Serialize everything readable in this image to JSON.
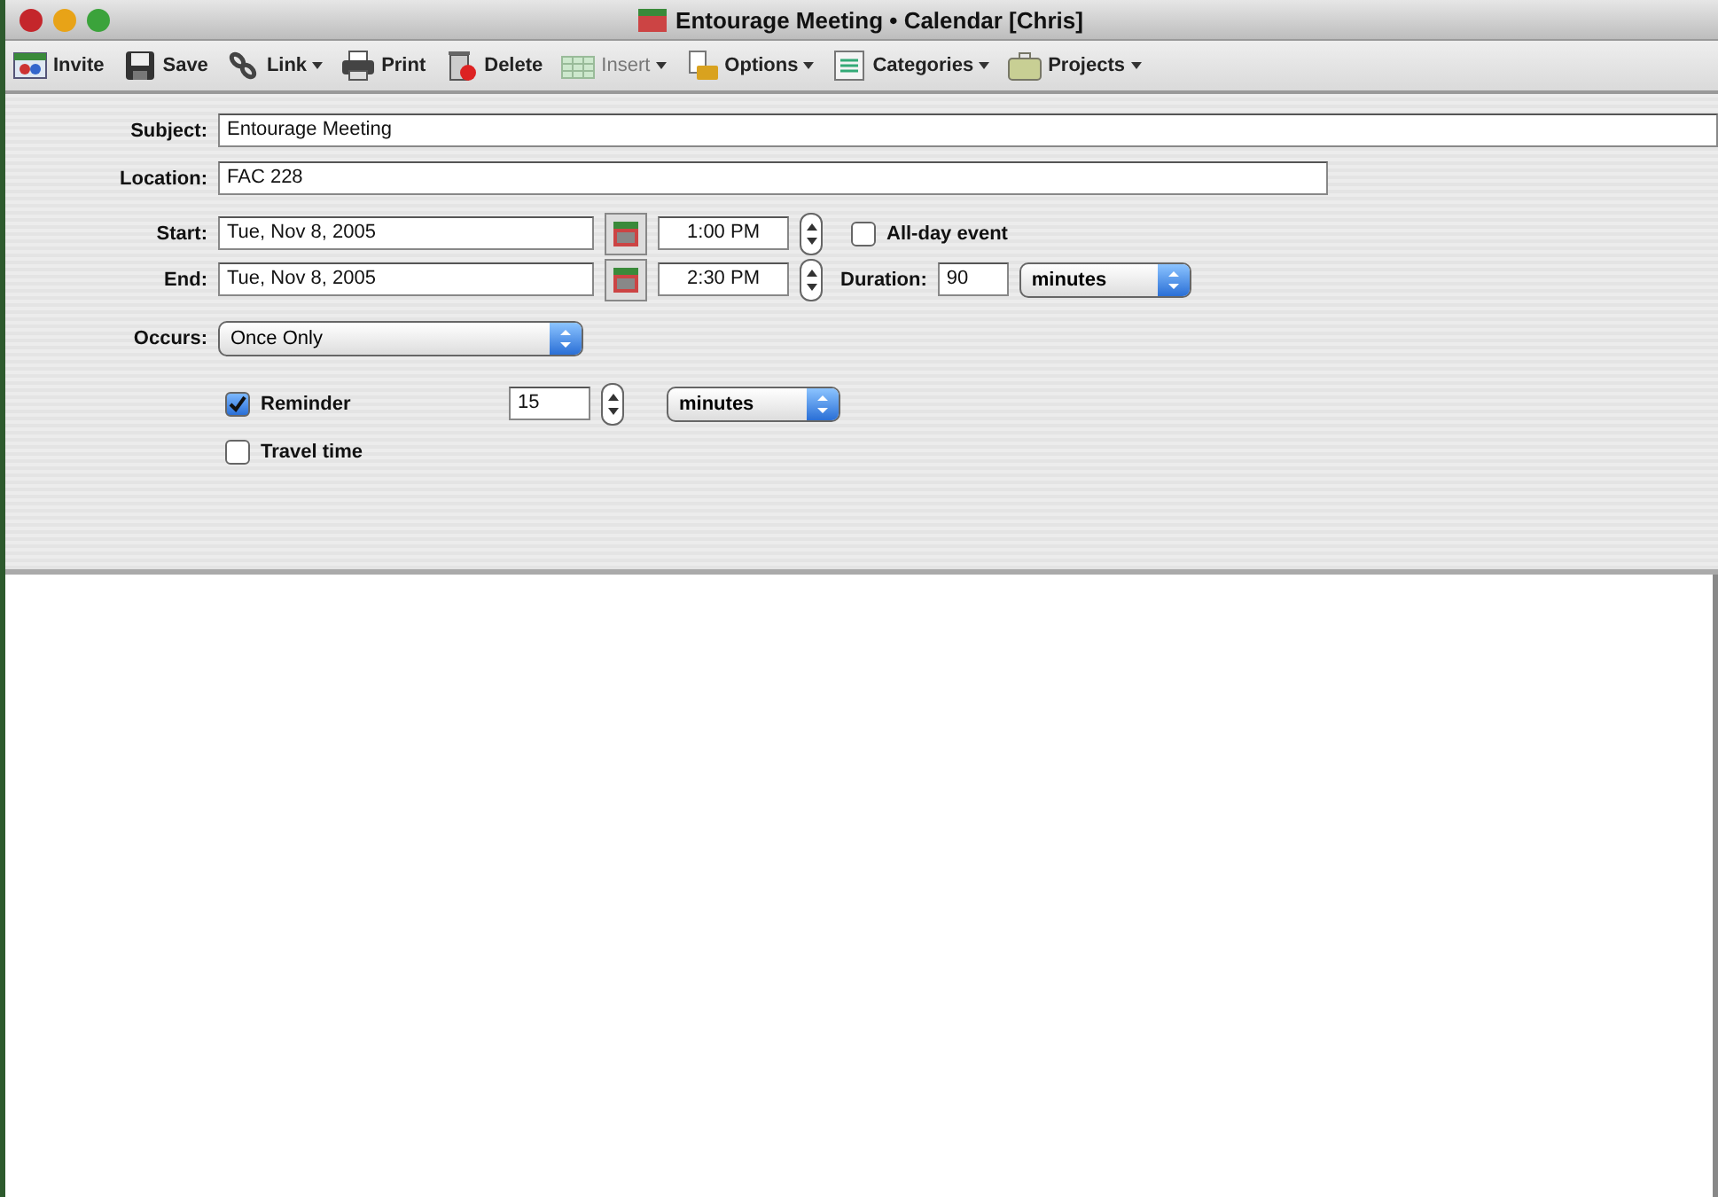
{
  "window": {
    "title": "Entourage Meeting • Calendar [Chris]"
  },
  "toolbar": [
    {
      "label": "Invite",
      "has_menu": false,
      "disabled": false
    },
    {
      "label": "Save",
      "has_menu": false,
      "disabled": false
    },
    {
      "label": "Link",
      "has_menu": true,
      "disabled": false
    },
    {
      "label": "Print",
      "has_menu": false,
      "disabled": false
    },
    {
      "label": "Delete",
      "has_menu": false,
      "disabled": false
    },
    {
      "label": "Insert",
      "has_menu": true,
      "disabled": true
    },
    {
      "label": "Options",
      "has_menu": true,
      "disabled": false
    },
    {
      "label": "Categories",
      "has_menu": true,
      "disabled": false
    },
    {
      "label": "Projects",
      "has_menu": true,
      "disabled": false
    }
  ],
  "form": {
    "subject": {
      "label": "Subject:",
      "value": "Entourage Meeting"
    },
    "location": {
      "label": "Location:",
      "value": "FAC 228"
    },
    "start": {
      "label": "Start:",
      "date": "Tue, Nov 8, 2005",
      "time": "1:00 PM"
    },
    "all_day": {
      "label": "All-day event",
      "checked": false
    },
    "end": {
      "label": "End:",
      "date": "Tue, Nov 8, 2005",
      "time": "2:30 PM"
    },
    "duration": {
      "label": "Duration:",
      "value": "90",
      "unit": "minutes"
    },
    "occurs": {
      "label": "Occurs:",
      "value": "Once Only"
    },
    "reminder": {
      "label": "Reminder",
      "checked": true,
      "value": "15",
      "unit": "minutes"
    },
    "travel_time": {
      "label": "Travel time",
      "checked": false
    }
  }
}
